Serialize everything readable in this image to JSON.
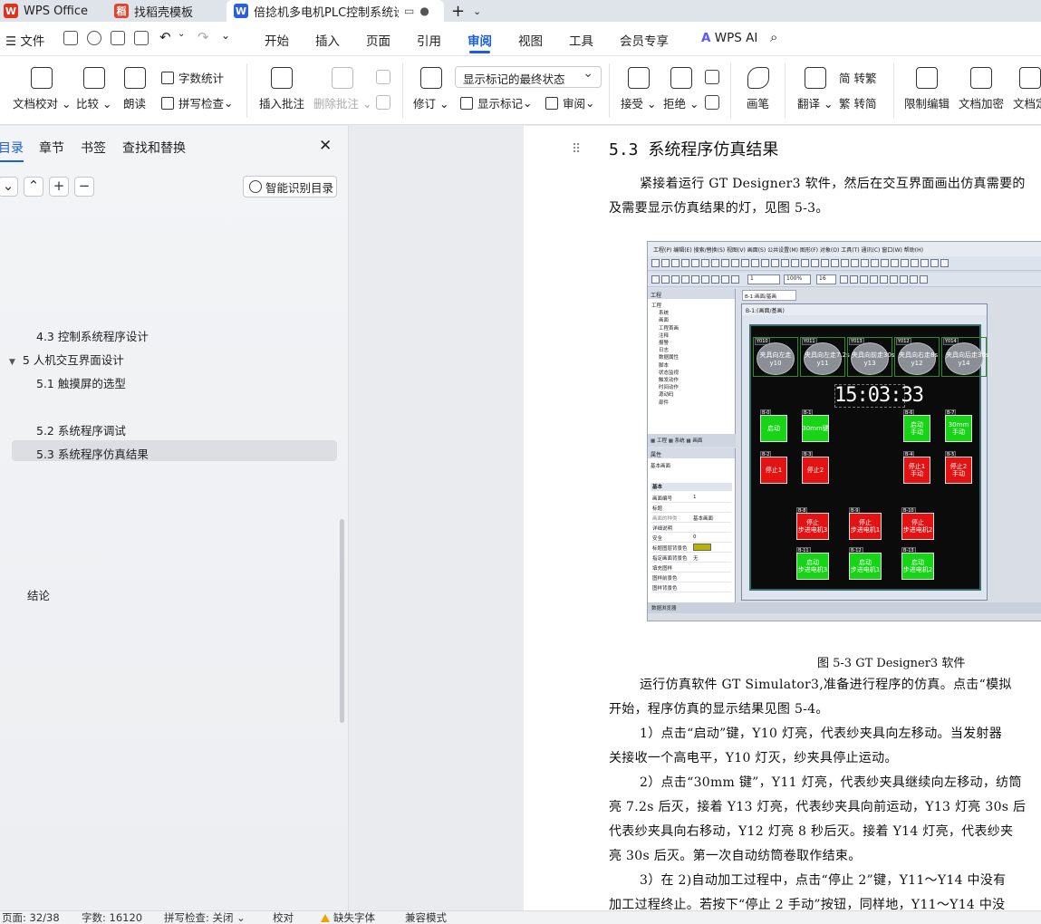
{
  "tabs": [
    {
      "label": "WPS Office",
      "color": "#e0301e",
      "glyph": "W"
    },
    {
      "label": "找稻壳模板",
      "color": "#e8412c",
      "glyph": "稻"
    },
    {
      "label": "倍捻机多电机PLC控制系统设计",
      "color": "#2b5fe0",
      "glyph": "W",
      "active": true
    }
  ],
  "menu": {
    "file": "文件",
    "items": [
      "开始",
      "插入",
      "页面",
      "引用",
      "审阅",
      "视图",
      "工具",
      "会员专享"
    ],
    "active": "审阅",
    "ai": "WPS AI"
  },
  "ribbon": {
    "doc_check": "文档校对",
    "compare": "比较",
    "read_aloud": "朗读",
    "word_count": "字数统计",
    "spell_check": "拼写检查",
    "insert_comment": "插入批注",
    "delete_comment": "删除批注",
    "revise": "修订",
    "mark_state": "显示标记的最终状态",
    "show_marks": "显示标记",
    "review": "审阅",
    "accept": "接受",
    "reject": "拒绝",
    "pen": "画笔",
    "translate": "翻译",
    "to_traditional": "转繁",
    "to_simplified": "转简",
    "restrict_edit": "限制编辑",
    "doc_encrypt": "文档加密",
    "doc_final": "文档定"
  },
  "nav": {
    "tabs": [
      "目录",
      "章节",
      "书签",
      "查找和替换"
    ],
    "smart_toc": "智能识别目录",
    "toc": [
      {
        "label": "4.3  控制系统程序设计",
        "level": 2
      },
      {
        "label": "5  人机交互界面设计",
        "level": 1
      },
      {
        "label": "5.1 触摸屏的选型",
        "level": 2
      },
      {
        "label": "5.2 系统程序调试",
        "level": 2
      },
      {
        "label": "5.3 系统程序仿真结果",
        "level": 2,
        "selected": true
      },
      {
        "label": "结论",
        "level": 1
      }
    ]
  },
  "doc": {
    "heading": "5.3 系统程序仿真结果",
    "para1a": "紧接着运行 GT Designer3 软件，然后在交互界面画出仿真需要的",
    "para1b": "及需要显示仿真结果的灯，见图 5-3。",
    "caption": "图 5-3  GT Designer3 软件",
    "lines": [
      "运行仿真软件 GT Simulator3,准备进行程序的仿真。点击“模拟",
      "开始，程序仿真的显示结果见图 5-4。",
      "1）点击“启动”键，Y10 灯亮，代表纱夹具向左移动。当发射器",
      "关接收一个高电平，Y10 灯灭，纱夹具停止运动。",
      "2）点击“30mm 键”，Y11 灯亮，代表纱夹具继续向左移动，纺筒",
      "亮 7.2s 后灭，接着 Y13 灯亮，代表纱夹具向前运动，Y13 灯亮 30s 后",
      "代表纱夹具向右移动，Y12 灯亮 8 秒后灭。接着 Y14 灯亮，代表纱夹",
      "亮 30s 后灭。第一次自动纺筒卷取作结束。",
      "3）在 2)自动加工过程中，点击“停止 2”键，Y11～Y14 中没有",
      "加工过程终止。若按下“停止 2 手动”按钮，同样地，Y11～Y14 中没"
    ]
  },
  "figure": {
    "menu": "工程(P)  编辑(E)  搜索/替换(S)  视图(V)  画面(S)  公共设置(M)  图形(F)  对象(O)  工具(T)  通讯(C)  窗口(W)  帮助(H)",
    "zoom": "100%",
    "num1": "1",
    "num16": "16",
    "tab_title": "B-1:画面/基画",
    "win_title": "B-1:(画面/基画)",
    "proj_title": "工程",
    "tree": [
      "工程",
      "系统",
      "画面",
      "工程首画",
      "注释",
      "报警",
      "日志",
      "数据属性",
      "脚本",
      "状态监视",
      "触发动作",
      "时间动作",
      "源动码",
      "部件"
    ],
    "props_title": "属性",
    "props_sub": "基本画面",
    "props_section": "基本",
    "props": [
      [
        "画面编号",
        "1"
      ],
      [
        "标题",
        ""
      ],
      [
        "画面的种类",
        "基本画面"
      ],
      [
        "详细说明",
        ""
      ],
      [
        "安全",
        "0"
      ],
      [
        "标题图层背景色",
        ""
      ],
      [
        "指定画面背景色",
        "无"
      ],
      [
        "填充图样",
        ""
      ],
      [
        "图样前景色",
        ""
      ],
      [
        "图样背景色",
        ""
      ]
    ],
    "bottom": "数据浏览器",
    "ovals": [
      {
        "tag": "Y010",
        "label": "夹具向左走\ny10"
      },
      {
        "tag": "Y011",
        "label": "夹具向左走7.2s\ny11"
      },
      {
        "tag": "Y013",
        "label": "夹具向前走30s\ny13"
      },
      {
        "tag": "Y012",
        "label": "夹具向右走8s\ny12"
      },
      {
        "tag": "Y014",
        "label": "夹具向后走30s\ny14"
      }
    ],
    "clock": "15:03:33",
    "buttons": [
      {
        "tag": "B-0",
        "label": "启动",
        "color": "g"
      },
      {
        "tag": "B-1",
        "label": "30mm键",
        "color": "g"
      },
      {
        "tag": "B-6",
        "label": "启动\n手动",
        "color": "g"
      },
      {
        "tag": "B-7",
        "label": "30mm\n手动",
        "color": "g"
      },
      {
        "tag": "B-2",
        "label": "停止1",
        "color": "r"
      },
      {
        "tag": "B-3",
        "label": "停止2",
        "color": "r"
      },
      {
        "tag": "B-4",
        "label": "停止1\n手动",
        "color": "r"
      },
      {
        "tag": "B-5",
        "label": "停止2\n手动",
        "color": "r"
      },
      {
        "tag": "B-8",
        "label": "停止\n步进电机3",
        "color": "r"
      },
      {
        "tag": "B-9",
        "label": "停止\n步进电机1",
        "color": "r"
      },
      {
        "tag": "B-10",
        "label": "停止\n步进电机2",
        "color": "r"
      },
      {
        "tag": "B-11",
        "label": "启动\n步进电机3",
        "color": "g"
      },
      {
        "tag": "B-12",
        "label": "启动\n步进电机1",
        "color": "g"
      },
      {
        "tag": "B-13",
        "label": "启动\n步进电机2",
        "color": "g"
      }
    ]
  },
  "status": {
    "page": "页面: 32/38",
    "words": "字数: 16120",
    "spell": "拼写检查: 关闭",
    "proof": "校对",
    "missing_font": "缺失字体",
    "compat": "兼容模式"
  },
  "colors": {
    "accent": "#1a5ed8",
    "green_button": "#17d417",
    "red_button": "#e41313"
  }
}
